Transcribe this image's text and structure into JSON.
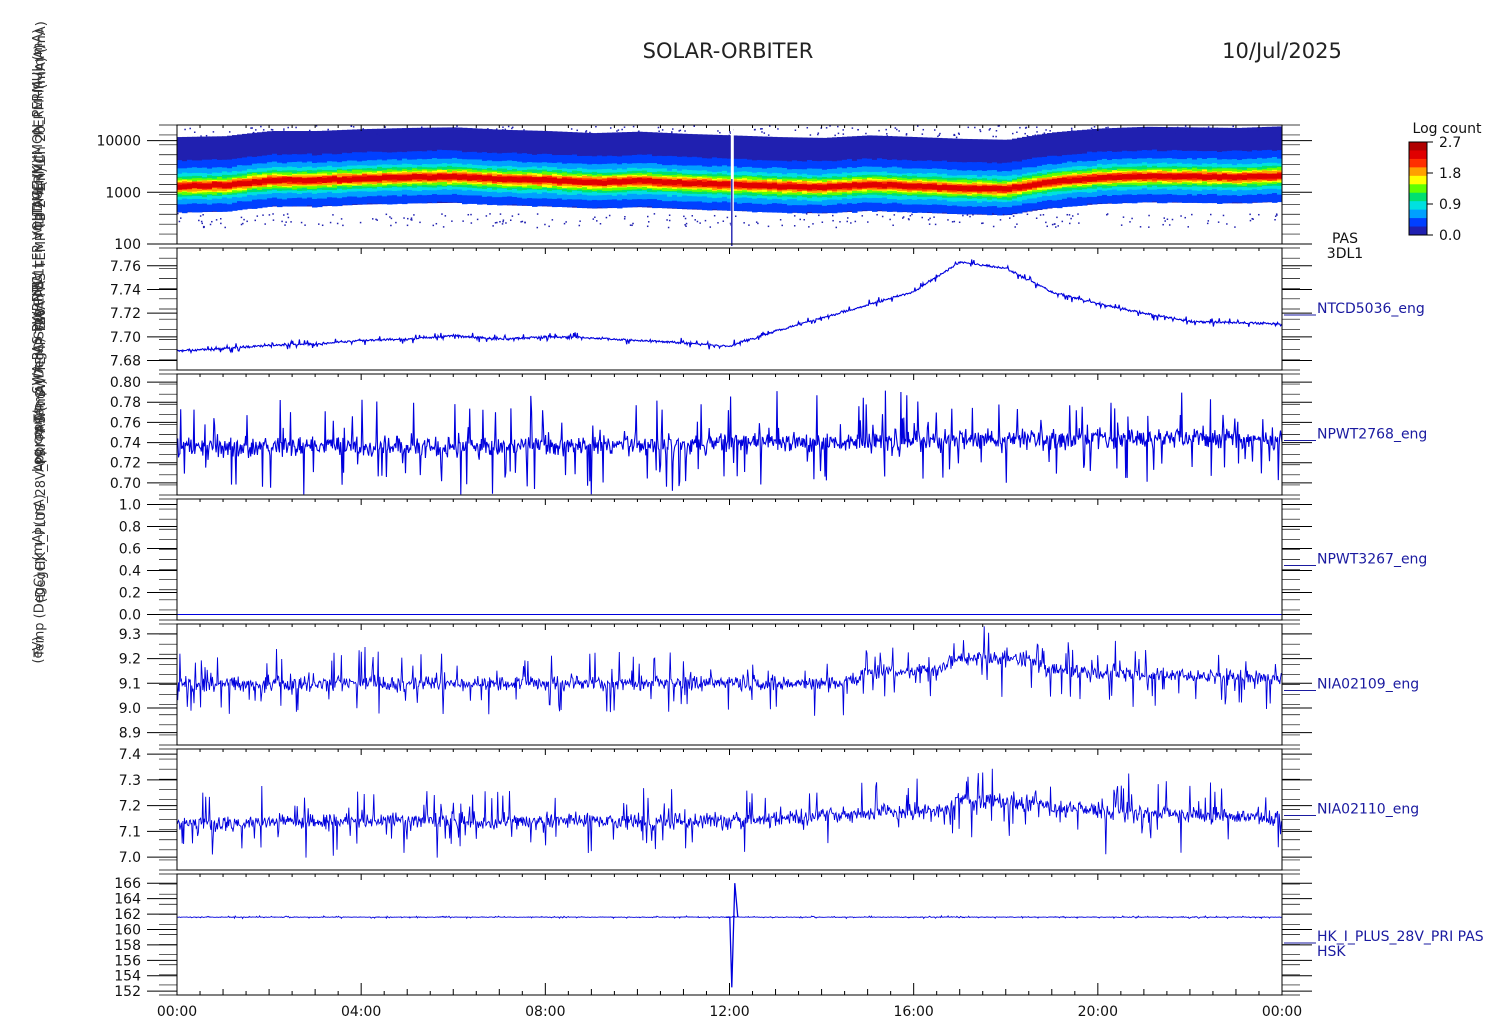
{
  "header": {
    "mission": "SOLAR-ORBITER",
    "date": "10/Jul/2025"
  },
  "overlapping_ylabels": [
    "(eV)",
    "Temp (DegC)",
    "(DegC)",
    "(mA)",
    "(mA)",
    "HK_I_PLUS_28V_PRI PAS (mA)",
    "Log count",
    "Approx Temp (DegC)",
    "PWR SW TEMP TB0",
    "SWA PAS PWRNTC",
    "SWA EAS 1L",
    "SWA PAS TEMP TB 2",
    "RPW LFR VOLTAGE (V)",
    "MLI THERMC",
    "4(n) Ch 20",
    "HDM_HK_IMON_PERMUL (mA)",
    "PERMHR (mA)",
    "(mA) (mA)"
  ],
  "colors": {
    "line": "#0000dd",
    "axis": "#000000",
    "label": "#1a1aa0"
  },
  "colorbar": {
    "title": "Log count",
    "ticks": [
      "2.7",
      "1.8",
      "0.9",
      "0.0"
    ],
    "colors": [
      "#2020b0",
      "#0040ff",
      "#00a0ff",
      "#00e0e0",
      "#00e070",
      "#60ff00",
      "#ffff00",
      "#ffa000",
      "#ff3000",
      "#e00000",
      "#b00000"
    ]
  },
  "chart_data": [
    {
      "panel": "spectrogram",
      "type": "heatmap",
      "label": [
        "PAS",
        "3DL1"
      ],
      "yscale": "log",
      "ylim": [
        100,
        20000
      ],
      "yticks": [
        "10000",
        "1000",
        "100"
      ],
      "ytick_values": [
        10000,
        1000,
        100
      ],
      "peak_energy_ev_hourly": [
        1300,
        1350,
        1700,
        1700,
        1850,
        1950,
        2000,
        1800,
        1700,
        1550,
        1650,
        1500,
        1400,
        1300,
        1250,
        1400,
        1300,
        1200,
        1150,
        1600,
        1900,
        2050,
        2000,
        1950,
        2100
      ]
    },
    {
      "panel": "ntcd",
      "type": "line",
      "label": "NTCD5036_eng",
      "ylim": [
        7.672,
        7.775
      ],
      "yticks": [
        "7.76",
        "7.74",
        "7.72",
        "7.70",
        "7.68"
      ],
      "ytick_values": [
        7.76,
        7.74,
        7.72,
        7.7,
        7.68
      ],
      "x_hours": [
        0,
        1,
        2,
        3,
        4,
        5,
        6,
        7,
        8,
        9,
        10,
        11,
        12,
        13,
        14,
        15,
        16,
        17,
        18,
        19,
        20,
        21,
        22,
        23,
        24
      ],
      "values": [
        7.688,
        7.69,
        7.693,
        7.694,
        7.697,
        7.698,
        7.701,
        7.698,
        7.7,
        7.699,
        7.697,
        7.695,
        7.692,
        7.705,
        7.716,
        7.727,
        7.738,
        7.763,
        7.758,
        7.738,
        7.728,
        7.72,
        7.713,
        7.712,
        7.711
      ],
      "noise": 0.004
    },
    {
      "panel": "npwt2768",
      "type": "line",
      "label": "NPWT2768_eng",
      "ylim": [
        0.688,
        0.808
      ],
      "yticks": [
        "0.80",
        "0.78",
        "0.76",
        "0.74",
        "0.72",
        "0.70"
      ],
      "ytick_values": [
        0.8,
        0.78,
        0.76,
        0.74,
        0.72,
        0.7
      ],
      "x_hours": [
        0,
        4,
        8,
        12,
        16,
        20,
        24
      ],
      "values": [
        0.735,
        0.736,
        0.736,
        0.74,
        0.742,
        0.744,
        0.744
      ],
      "noise": 0.045
    },
    {
      "panel": "npwt3267",
      "type": "line",
      "label": "NPWT3267_eng",
      "ylim": [
        -0.05,
        1.05
      ],
      "yticks": [
        "1.0",
        "0.8",
        "0.6",
        "0.4",
        "0.2",
        "0.0"
      ],
      "ytick_values": [
        1.0,
        0.8,
        0.6,
        0.4,
        0.2,
        0.0
      ],
      "x_hours": [
        0,
        24
      ],
      "values": [
        0.0,
        0.0
      ],
      "noise": 0.0
    },
    {
      "panel": "nia02109",
      "type": "line",
      "label": "NIA02109_eng",
      "ylim": [
        8.85,
        9.34
      ],
      "yticks": [
        "9.3",
        "9.2",
        "9.1",
        "9.0",
        "8.9"
      ],
      "ytick_values": [
        9.3,
        9.2,
        9.1,
        9.0,
        8.9
      ],
      "x_hours": [
        0,
        4,
        8,
        12,
        14.5,
        15,
        16.5,
        17,
        18.5,
        19,
        24
      ],
      "values": [
        9.1,
        9.1,
        9.1,
        9.1,
        9.1,
        9.15,
        9.15,
        9.2,
        9.2,
        9.15,
        9.12
      ],
      "noise": 0.13
    },
    {
      "panel": "nia02110",
      "type": "line",
      "label": "NIA02110_eng",
      "ylim": [
        6.95,
        7.42
      ],
      "yticks": [
        "7.4",
        "7.3",
        "7.2",
        "7.1",
        "7.0"
      ],
      "ytick_values": [
        7.4,
        7.3,
        7.2,
        7.1,
        7.0
      ],
      "x_hours": [
        0,
        4,
        8,
        12,
        15,
        16.5,
        17,
        18.5,
        19,
        24
      ],
      "values": [
        7.13,
        7.14,
        7.14,
        7.14,
        7.17,
        7.18,
        7.22,
        7.22,
        7.19,
        7.15
      ],
      "noise": 0.13
    },
    {
      "panel": "hk28v",
      "type": "line",
      "label": [
        "HK_I_PLUS_28V_PRI PAS",
        "HSK"
      ],
      "ylim": [
        151.5,
        167.2
      ],
      "yticks": [
        "166",
        "164",
        "162",
        "160",
        "158",
        "156",
        "154",
        "152"
      ],
      "ytick_values": [
        166,
        164,
        162,
        160,
        158,
        156,
        154,
        152
      ],
      "x_hours": [
        0,
        12,
        24
      ],
      "values": [
        161.6,
        161.6,
        161.6
      ],
      "noise": 0.15,
      "spike": {
        "x_hours": 12.05,
        "min": 152.5,
        "max": 166.0
      }
    }
  ],
  "xaxis": {
    "ticks": [
      "00:00",
      "04:00",
      "08:00",
      "12:00",
      "16:00",
      "20:00",
      "00:00"
    ],
    "tick_hours": [
      0,
      4,
      8,
      12,
      16,
      20,
      24
    ]
  }
}
